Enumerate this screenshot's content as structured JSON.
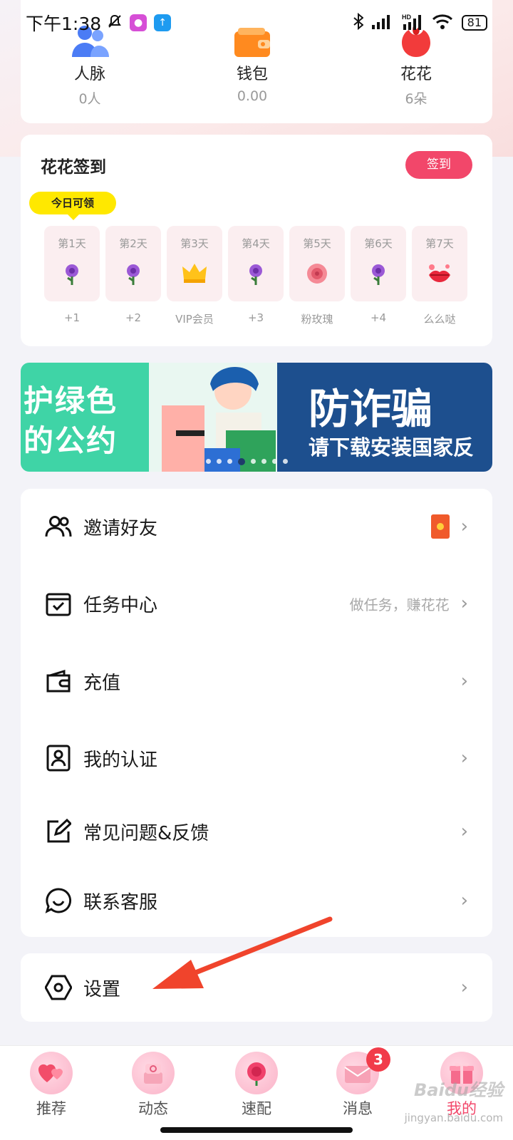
{
  "status_bar": {
    "time": "下午1:38",
    "battery": "81"
  },
  "stats": {
    "contacts": {
      "label": "人脉",
      "value": "0人"
    },
    "wallet": {
      "label": "钱包",
      "value": "0.00"
    },
    "flowers": {
      "label": "花花",
      "value": "6朵"
    }
  },
  "checkin": {
    "title": "花花签到",
    "button_label": "签到",
    "today_badge": "今日可领",
    "days": [
      {
        "name": "第1天",
        "reward": "+1",
        "icon": "purple-rose-icon"
      },
      {
        "name": "第2天",
        "reward": "+2",
        "icon": "purple-rose-icon"
      },
      {
        "name": "第3天",
        "reward": "VIP会员",
        "icon": "crown-icon"
      },
      {
        "name": "第4天",
        "reward": "+3",
        "icon": "purple-rose-icon"
      },
      {
        "name": "第5天",
        "reward": "粉玫瑰",
        "icon": "pink-rose-icon"
      },
      {
        "name": "第6天",
        "reward": "+4",
        "icon": "purple-rose-icon"
      },
      {
        "name": "第7天",
        "reward": "么么哒",
        "icon": "kiss-lips-icon"
      }
    ]
  },
  "banner": {
    "left_line1": "护绿色",
    "left_line2": "的公约",
    "right_title": "防诈骗",
    "right_subtitle": "请下载安装国家反"
  },
  "menu": {
    "invite": {
      "label": "邀请好友"
    },
    "tasks": {
      "label": "任务中心",
      "hint": "做任务，赚花花"
    },
    "recharge": {
      "label": "充值"
    },
    "verify": {
      "label": "我的认证"
    },
    "faq": {
      "label": "常见问题&反馈"
    },
    "support": {
      "label": "联系客服"
    },
    "settings": {
      "label": "设置"
    }
  },
  "bottom_nav": {
    "items": [
      {
        "label": "推荐"
      },
      {
        "label": "动态"
      },
      {
        "label": "速配"
      },
      {
        "label": "消息",
        "badge": "3"
      },
      {
        "label": "我的"
      }
    ]
  },
  "watermark": {
    "brand": "Baidu经验",
    "url": "jingyan.baidu.com"
  },
  "colors": {
    "accent": "#f2476a",
    "badge_yellow": "#ffe800",
    "arrow": "#f0442c"
  }
}
